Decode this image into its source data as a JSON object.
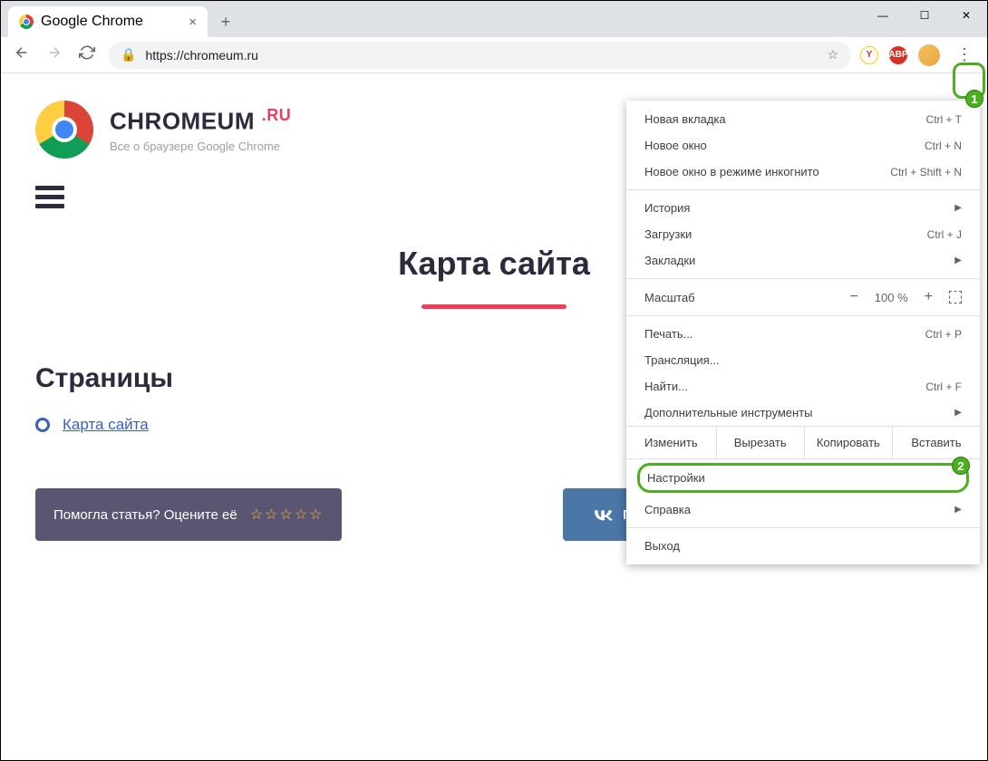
{
  "tab": {
    "title": "Google Chrome"
  },
  "url": "https://chromeum.ru",
  "toolbar": {
    "star": "☆"
  },
  "extensions": {
    "yandex": "Y",
    "abp": "ABP"
  },
  "menu": {
    "new_tab": {
      "label": "Новая вкладка",
      "shortcut": "Ctrl + T"
    },
    "new_window": {
      "label": "Новое окно",
      "shortcut": "Ctrl + N"
    },
    "incognito": {
      "label": "Новое окно в режиме инкогнито",
      "shortcut": "Ctrl + Shift + N"
    },
    "history": {
      "label": "История"
    },
    "downloads": {
      "label": "Загрузки",
      "shortcut": "Ctrl + J"
    },
    "bookmarks": {
      "label": "Закладки"
    },
    "zoom": {
      "label": "Масштаб",
      "value": "100 %"
    },
    "print": {
      "label": "Печать...",
      "shortcut": "Ctrl + P"
    },
    "cast": {
      "label": "Трансляция..."
    },
    "find": {
      "label": "Найти...",
      "shortcut": "Ctrl + F"
    },
    "more_tools": {
      "label": "Дополнительные инструменты"
    },
    "edit": {
      "label": "Изменить",
      "cut": "Вырезать",
      "copy": "Копировать",
      "paste": "Вставить"
    },
    "settings": {
      "label": "Настройки"
    },
    "help": {
      "label": "Справка"
    },
    "exit": {
      "label": "Выход"
    }
  },
  "badges": {
    "one": "1",
    "two": "2"
  },
  "site": {
    "brand": "CHROMEUM",
    "brand_suffix": ".RU",
    "tagline": "Все о браузере Google Chrome",
    "page_title": "Карта сайта",
    "section": "Страницы",
    "link": "Карта сайта",
    "rate_text": "Помогла статья? Оцените её",
    "stars": "☆☆☆☆☆",
    "share_vk": "Поделиться"
  }
}
